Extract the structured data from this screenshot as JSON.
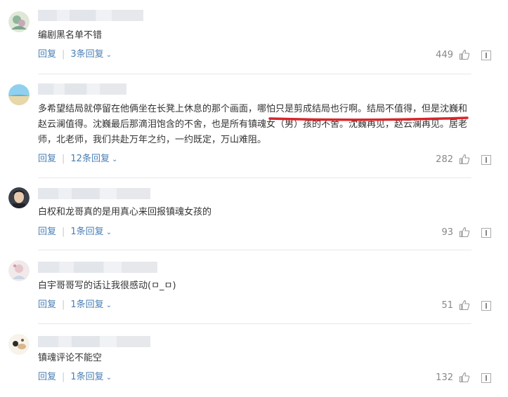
{
  "ui": {
    "reply_label": "回复",
    "separator": "|"
  },
  "comments": [
    {
      "text": "编剧黑名单不错",
      "replies_label": "3条回复",
      "likes": "449"
    },
    {
      "text": "多希望结局就停留在他俩坐在长凳上休息的那个画面，哪怕只是剪成结局也行啊。结局不值得，但是沈巍和赵云澜值得。沈巍最后那滴泪饱含的不舍，也是所有镇魂女（男）孩的不舍。沈巍再见，赵云澜再见。居老师，北老师，我们共赴万年之约，一约既定，万山难阻。",
      "replies_label": "12条回复",
      "likes": "282"
    },
    {
      "text": "白权和龙哥真的是用真心来回报镇魂女孩的",
      "replies_label": "1条回复",
      "likes": "93"
    },
    {
      "text": "白宇哥哥写的话让我很感动(ㅁ_ㅁ)",
      "replies_label": "1条回复",
      "likes": "51"
    },
    {
      "text": "镇魂评论不能空",
      "replies_label": "1条回复",
      "likes": "132"
    }
  ],
  "colors": {
    "link": "#4a7fb5",
    "text": "#333333",
    "muted": "#888888",
    "highlight_underline": "#d8262b"
  },
  "icons": {
    "like": "thumbs-up-icon",
    "report": "report-icon",
    "expand": "chevron-down-icon"
  }
}
